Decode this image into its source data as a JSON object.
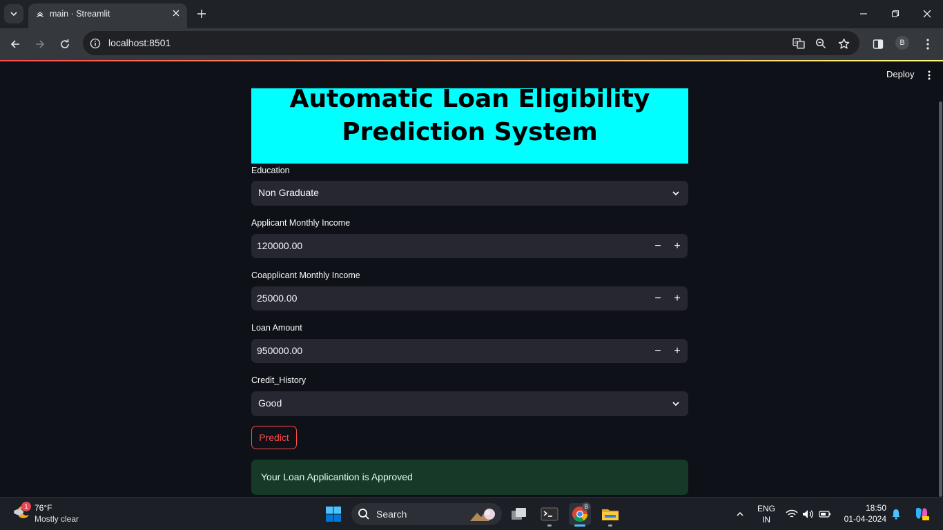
{
  "browser": {
    "tab_title": "main · Streamlit",
    "url": "localhost:8501",
    "profile_initial": "B"
  },
  "app": {
    "deploy_label": "Deploy",
    "title": "Automatic Loan Eligibility Prediction System",
    "title_line1": "Automatic Loan Eligibility",
    "title_line2": "Prediction System",
    "fields": {
      "education": {
        "label": "Education",
        "value": "Non Graduate"
      },
      "applicant_income": {
        "label": "Applicant Monthly Income",
        "value": "120000.00"
      },
      "coapplicant_income": {
        "label": "Coapplicant Monthly Income",
        "value": "25000.00"
      },
      "loan_amount": {
        "label": "Loan Amount",
        "value": "950000.00"
      },
      "credit_history": {
        "label": "Credit_History",
        "value": "Good"
      }
    },
    "stepper": {
      "minus": "−",
      "plus": "+"
    },
    "predict_label": "Predict",
    "result": "Your Loan Applicantion is Approved",
    "colors": {
      "accent": "#ff4b4b",
      "header_bg": "#00ffff",
      "success_bg": "#173928"
    }
  },
  "taskbar": {
    "weather_temp": "76°F",
    "weather_desc": "Mostly clear",
    "weather_badge": "1",
    "search_label": "Search",
    "lang_line1": "ENG",
    "lang_line2": "IN",
    "time": "18:50",
    "date": "01-04-2024",
    "chrome_badge": "B"
  }
}
